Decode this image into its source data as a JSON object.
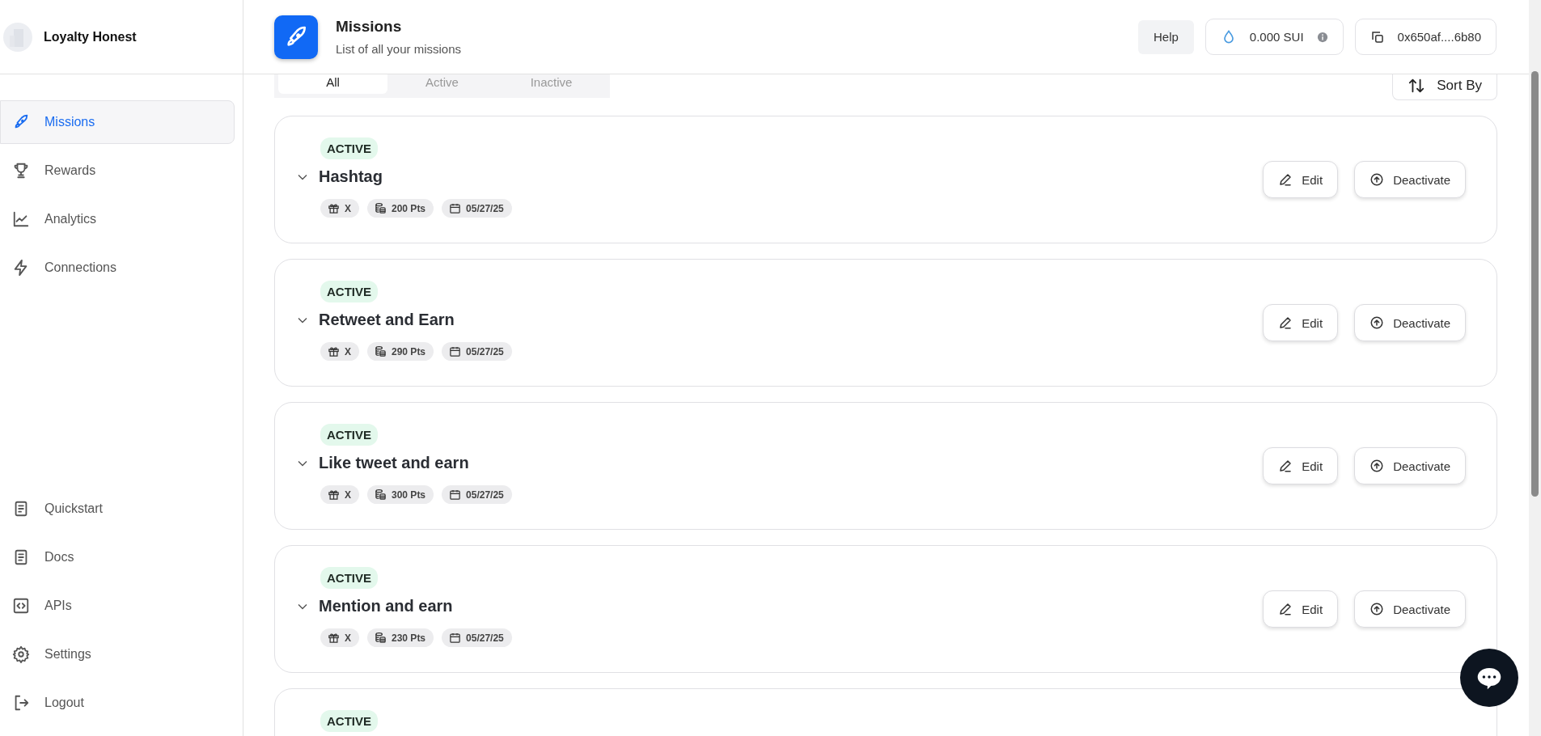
{
  "brand": {
    "name": "Loyalty Honest"
  },
  "sidebar": {
    "items": [
      {
        "label": "Missions",
        "selected": true
      },
      {
        "label": "Rewards",
        "selected": false
      },
      {
        "label": "Analytics",
        "selected": false
      },
      {
        "label": "Connections",
        "selected": false
      }
    ],
    "bottom_items": [
      {
        "label": "Quickstart"
      },
      {
        "label": "Docs"
      },
      {
        "label": "APIs"
      },
      {
        "label": "Settings"
      },
      {
        "label": "Logout"
      }
    ]
  },
  "header": {
    "title": "Missions",
    "subtitle": "List of all your missions",
    "help": "Help",
    "balance": "0.000 SUI",
    "wallet": "0x650af....6b80"
  },
  "tabs": [
    {
      "label": "All",
      "selected": true
    },
    {
      "label": "Active",
      "selected": false
    },
    {
      "label": "Inactive",
      "selected": false
    }
  ],
  "sort_button": "Sort By",
  "missions": [
    {
      "status": "ACTIVE",
      "title": "Hashtag",
      "platform": "X",
      "points": "200 Pts",
      "date": "05/27/25",
      "edit": "Edit",
      "toggle": "Deactivate"
    },
    {
      "status": "ACTIVE",
      "title": "Retweet and Earn",
      "platform": "X",
      "points": "290 Pts",
      "date": "05/27/25",
      "edit": "Edit",
      "toggle": "Deactivate"
    },
    {
      "status": "ACTIVE",
      "title": "Like tweet and earn",
      "platform": "X",
      "points": "300 Pts",
      "date": "05/27/25",
      "edit": "Edit",
      "toggle": "Deactivate"
    },
    {
      "status": "ACTIVE",
      "title": "Mention and earn",
      "platform": "X",
      "points": "230 Pts",
      "date": "05/27/25",
      "edit": "Edit",
      "toggle": "Deactivate"
    },
    {
      "status": "ACTIVE"
    }
  ]
}
